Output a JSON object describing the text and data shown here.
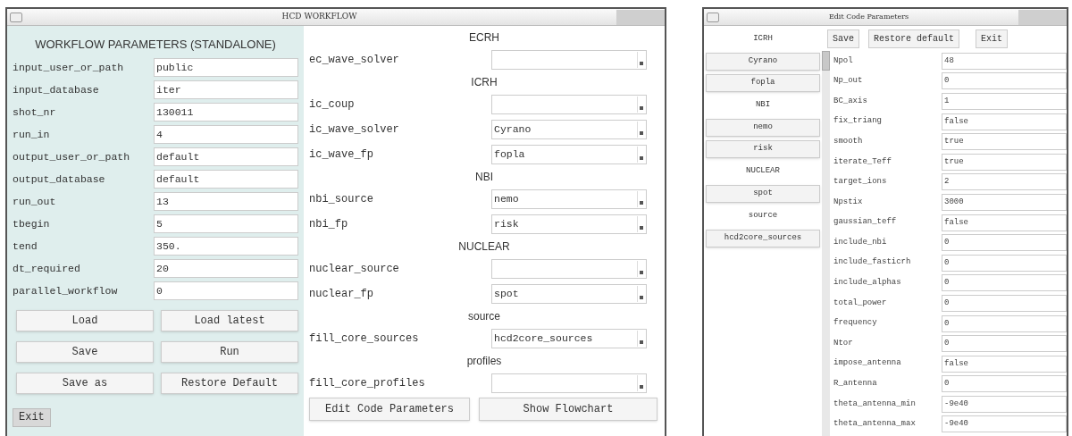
{
  "main_window": {
    "title": "HCD WORKFLOW",
    "workflow_panel": {
      "heading": "WORKFLOW PARAMETERS (STANDALONE)",
      "fields": [
        {
          "label": "input_user_or_path",
          "value": "public"
        },
        {
          "label": "input_database",
          "value": "iter"
        },
        {
          "label": "shot_nr",
          "value": "130011"
        },
        {
          "label": "run_in",
          "value": "4"
        },
        {
          "label": "output_user_or_path",
          "value": "default"
        },
        {
          "label": "output_database",
          "value": "default"
        },
        {
          "label": "run_out",
          "value": "13"
        },
        {
          "label": "tbegin",
          "value": "5"
        },
        {
          "label": "tend",
          "value": "350."
        },
        {
          "label": "dt_required",
          "value": "20"
        },
        {
          "label": "parallel_workflow",
          "value": "0"
        }
      ],
      "buttons": [
        "Load",
        "Load latest",
        "Save",
        "Run",
        "Save as",
        "Restore Default"
      ],
      "exit_button": "Exit"
    },
    "actors": [
      {
        "kind": "heading",
        "text": "ECRH"
      },
      {
        "kind": "dropdown",
        "label": "ec_wave_solver"
      },
      {
        "kind": "heading",
        "text": "ICRH"
      },
      {
        "kind": "dropdown",
        "label": "ic_coup"
      },
      {
        "kind": "dropdown",
        "label": "ic_wave_solver",
        "value": "Cyrano"
      },
      {
        "kind": "dropdown",
        "label": "ic_wave_fp",
        "value": "fopla"
      },
      {
        "kind": "heading",
        "text": "NBI"
      },
      {
        "kind": "dropdown",
        "label": "nbi_source",
        "value": "nemo"
      },
      {
        "kind": "dropdown",
        "label": "nbi_fp",
        "value": "risk"
      },
      {
        "kind": "heading",
        "text": "NUCLEAR"
      },
      {
        "kind": "dropdown",
        "label": "nuclear_source"
      },
      {
        "kind": "dropdown",
        "label": "nuclear_fp",
        "value": "spot"
      },
      {
        "kind": "heading",
        "text": "source"
      },
      {
        "kind": "dropdown",
        "label": "fill_core_sources",
        "value": "hcd2core_sources"
      },
      {
        "kind": "heading",
        "text": "profiles"
      },
      {
        "kind": "dropdown",
        "label": "fill_core_profiles"
      }
    ],
    "buttons": [
      "Edit Code Parameters",
      "Show Flowchart"
    ]
  },
  "code_window": {
    "title": "Edit Code Parameters",
    "codes": [
      {
        "kind": "heading",
        "text": "ICRH"
      },
      {
        "kind": "button",
        "text": "Cyrano"
      },
      {
        "kind": "button",
        "text": "fopla"
      },
      {
        "kind": "heading",
        "text": "NBI"
      },
      {
        "kind": "button",
        "text": "nemo"
      },
      {
        "kind": "button",
        "text": "risk"
      },
      {
        "kind": "heading",
        "text": "NUCLEAR"
      },
      {
        "kind": "button",
        "text": "spot"
      },
      {
        "kind": "heading",
        "text": "source"
      },
      {
        "kind": "button",
        "text": "hcd2core_sources"
      }
    ],
    "toolbar": [
      "Save",
      "Restore default",
      "Exit"
    ],
    "parameters": [
      {
        "label": "Npol",
        "value": "48"
      },
      {
        "label": "Np_out",
        "value": "0"
      },
      {
        "label": "BC_axis",
        "value": "1"
      },
      {
        "label": "fix_triang",
        "value": "false"
      },
      {
        "label": "smooth",
        "value": "true"
      },
      {
        "label": "iterate_Teff",
        "value": "true"
      },
      {
        "label": "target_ions",
        "value": "2"
      },
      {
        "label": "Npstix",
        "value": "3000"
      },
      {
        "label": "gaussian_teff",
        "value": "false"
      },
      {
        "label": "include_nbi",
        "value": "0"
      },
      {
        "label": "include_fasticrh",
        "value": "0"
      },
      {
        "label": "include_alphas",
        "value": "0"
      },
      {
        "label": "total_power",
        "value": "0"
      },
      {
        "label": "frequency",
        "value": "0"
      },
      {
        "label": "Ntor",
        "value": "0"
      },
      {
        "label": "impose_antenna",
        "value": "false"
      },
      {
        "label": "R_antenna",
        "value": "0"
      },
      {
        "label": "theta_antenna_min",
        "value": "-9e40"
      },
      {
        "label": "theta_antenna_max",
        "value": "-9e40"
      }
    ]
  }
}
